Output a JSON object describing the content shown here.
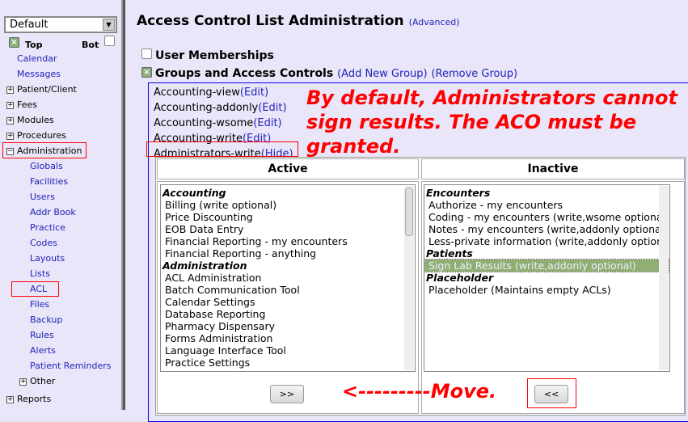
{
  "sidebar": {
    "select_value": "Default",
    "top_label": "Top",
    "bot_label": "Bot",
    "items": [
      {
        "label": "Calendar",
        "type": "link"
      },
      {
        "label": "Messages",
        "type": "link"
      },
      {
        "label": "Patient/Client",
        "type": "folder"
      },
      {
        "label": "Fees",
        "type": "folder"
      },
      {
        "label": "Modules",
        "type": "folder"
      },
      {
        "label": "Procedures",
        "type": "folder"
      },
      {
        "label": "Administration",
        "type": "open"
      }
    ],
    "admin_items": [
      "Globals",
      "Facilities",
      "Users",
      "Addr Book",
      "Practice",
      "Codes",
      "Layouts",
      "Lists",
      "ACL",
      "Files",
      "Backup",
      "Rules",
      "Alerts",
      "Patient Reminders"
    ],
    "other": "Other",
    "reports": "Reports"
  },
  "main": {
    "title": "Access Control List Administration",
    "advanced": "(Advanced)",
    "user_memberships": "User Memberships",
    "groups_label": "Groups and Access Controls",
    "add_group": "(Add New Group)",
    "remove_group": "(Remove Group)",
    "groups": [
      {
        "name": "Accounting-view",
        "action": "(Edit)"
      },
      {
        "name": "Accounting-addonly",
        "action": "(Edit)"
      },
      {
        "name": "Accounting-wsome",
        "action": "(Edit)"
      },
      {
        "name": "Accounting-write",
        "action": "(Edit)"
      },
      {
        "name": "Administrators-write",
        "action": "(Hide)"
      }
    ],
    "annotation": [
      "By default, Administrators cannot",
      "sign results.  The ACO must be",
      "granted."
    ],
    "move_annotation": "<---------Move.",
    "active_header": "Active",
    "inactive_header": "Inactive",
    "active_list": [
      {
        "t": "Accounting",
        "g": true
      },
      {
        "t": "Billing (write optional)"
      },
      {
        "t": "Price Discounting"
      },
      {
        "t": "EOB Data Entry"
      },
      {
        "t": "Financial Reporting - my encounters"
      },
      {
        "t": "Financial Reporting - anything"
      },
      {
        "t": "Administration",
        "g": true
      },
      {
        "t": "ACL Administration"
      },
      {
        "t": "Batch Communication Tool"
      },
      {
        "t": "Calendar Settings"
      },
      {
        "t": "Database Reporting"
      },
      {
        "t": "Pharmacy Dispensary"
      },
      {
        "t": "Forms Administration"
      },
      {
        "t": "Language Interface Tool"
      },
      {
        "t": "Practice Settings"
      }
    ],
    "inactive_list": [
      {
        "t": "Encounters",
        "g": true
      },
      {
        "t": "Authorize - my encounters"
      },
      {
        "t": "Coding - my encounters (write,wsome optional)"
      },
      {
        "t": "Notes - my encounters (write,addonly optional)"
      },
      {
        "t": "Less-private information (write,addonly optional)"
      },
      {
        "t": "Patients",
        "g": true
      },
      {
        "t": "Sign Lab Results (write,addonly optional)",
        "selected": true
      },
      {
        "t": "Placeholder",
        "g": true
      },
      {
        "t": "Placeholder (Maintains empty ACLs)"
      }
    ],
    "add_btn": ">>",
    "remove_btn": "<<"
  },
  "colors": {
    "link": "#2222bb",
    "annotation": "#ff0000",
    "selected": "#8fae72",
    "background": "#e8e6f8"
  }
}
